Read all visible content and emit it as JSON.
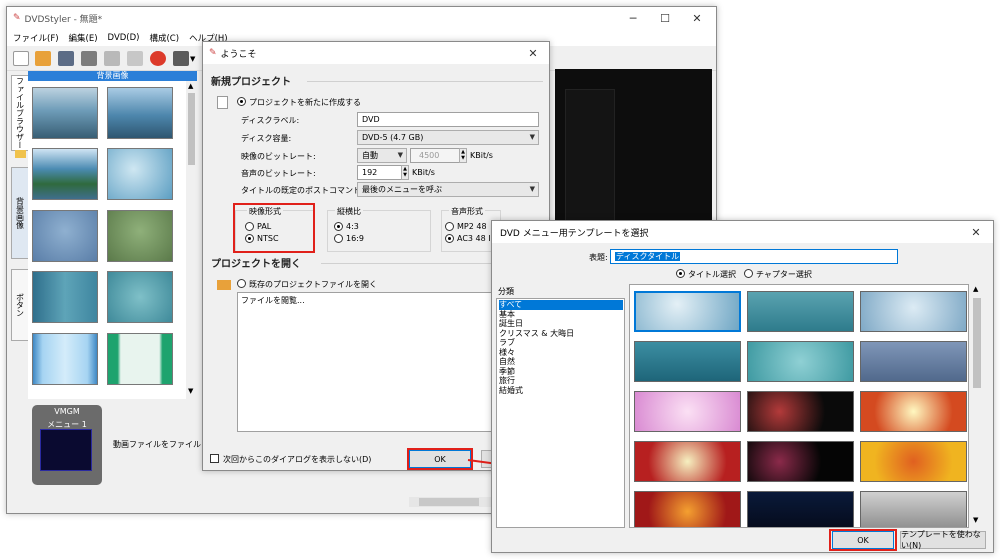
{
  "main_window": {
    "title": "DVDStyler - 無題*",
    "menu": [
      "ファイル(F)",
      "編集(E)",
      "DVD(D)",
      "構成(C)",
      "ヘルプ(H)"
    ],
    "browser_header": "背景画像",
    "side_tabs": [
      "ファイルブラウザー",
      "背景画像",
      "ボタン"
    ],
    "vmgm_label": "VMGM",
    "menu_item_label": "メニュー 1",
    "hint_text": "動画ファイルをファイルブラウ"
  },
  "welcome_dialog": {
    "title": "ようこそ",
    "new_project_header": "新規プロジェクト",
    "create_new_label": "プロジェクトを新たに作成する",
    "disc_label_label": "ディスクラベル:",
    "disc_label_value": "DVD",
    "disc_capacity_label": "ディスク容量:",
    "disc_capacity_value": "DVD-5 (4.7 GB)",
    "video_bitrate_label": "映像のビットレート:",
    "video_bitrate_mode": "自動",
    "video_bitrate_value": "4500",
    "video_bitrate_unit": "KBit/s",
    "audio_bitrate_label": "音声のビットレート:",
    "audio_bitrate_value": "192",
    "audio_bitrate_unit": "KBit/s",
    "post_command_label": "タイトルの既定のポストコマンド:",
    "post_command_value": "最後のメニューを呼ぶ",
    "video_format_header": "映像形式",
    "pal_label": "PAL",
    "ntsc_label": "NTSC",
    "aspect_header": "縦横比",
    "aspect_43": "4:3",
    "aspect_169": "16:9",
    "audio_format_header": "音声形式",
    "audio_mp2": "MP2 48",
    "audio_ac3": "AC3 48 I",
    "open_project_header": "プロジェクトを開く",
    "open_existing_label": "既存のプロジェクトファイルを開く",
    "browse_item": "ファイルを閲覧...",
    "dont_show_label": "次回からこのダイアログを表示しない(D)",
    "ok_label": "OK"
  },
  "template_dialog": {
    "title": "DVD メニュー用テンプレートを選択",
    "title_label": "表題:",
    "title_value": "ディスクタイトル",
    "radio_title": "タイトル選択",
    "radio_chapter": "チャプター選択",
    "category_header": "分類",
    "categories": [
      "すべて",
      "基本",
      "誕生日",
      "クリスマス & 大晦日",
      "ラブ",
      "様々",
      "自然",
      "季節",
      "旅行",
      "結婚式"
    ],
    "ok_label": "OK",
    "no_template_label": "テンプレートを使わない(N)"
  },
  "colors": {
    "highlight_red": "#e0201a",
    "selection_blue": "#0078d7",
    "header_blue": "#2b7fd8"
  }
}
